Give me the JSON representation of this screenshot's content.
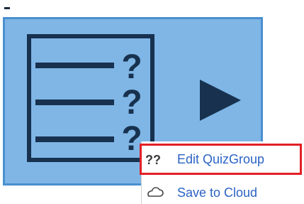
{
  "menu": {
    "items": [
      {
        "label": "Edit QuizGroup",
        "icon": "question-pair-icon"
      },
      {
        "label": "Save to Cloud",
        "icon": "cloud-icon"
      }
    ]
  },
  "colors": {
    "tile_fill": "#7fb6e6",
    "tile_border": "#4a8fd0",
    "icon_dark": "#17314f",
    "menu_text": "#2b63c4",
    "highlight": "#e21f26"
  }
}
